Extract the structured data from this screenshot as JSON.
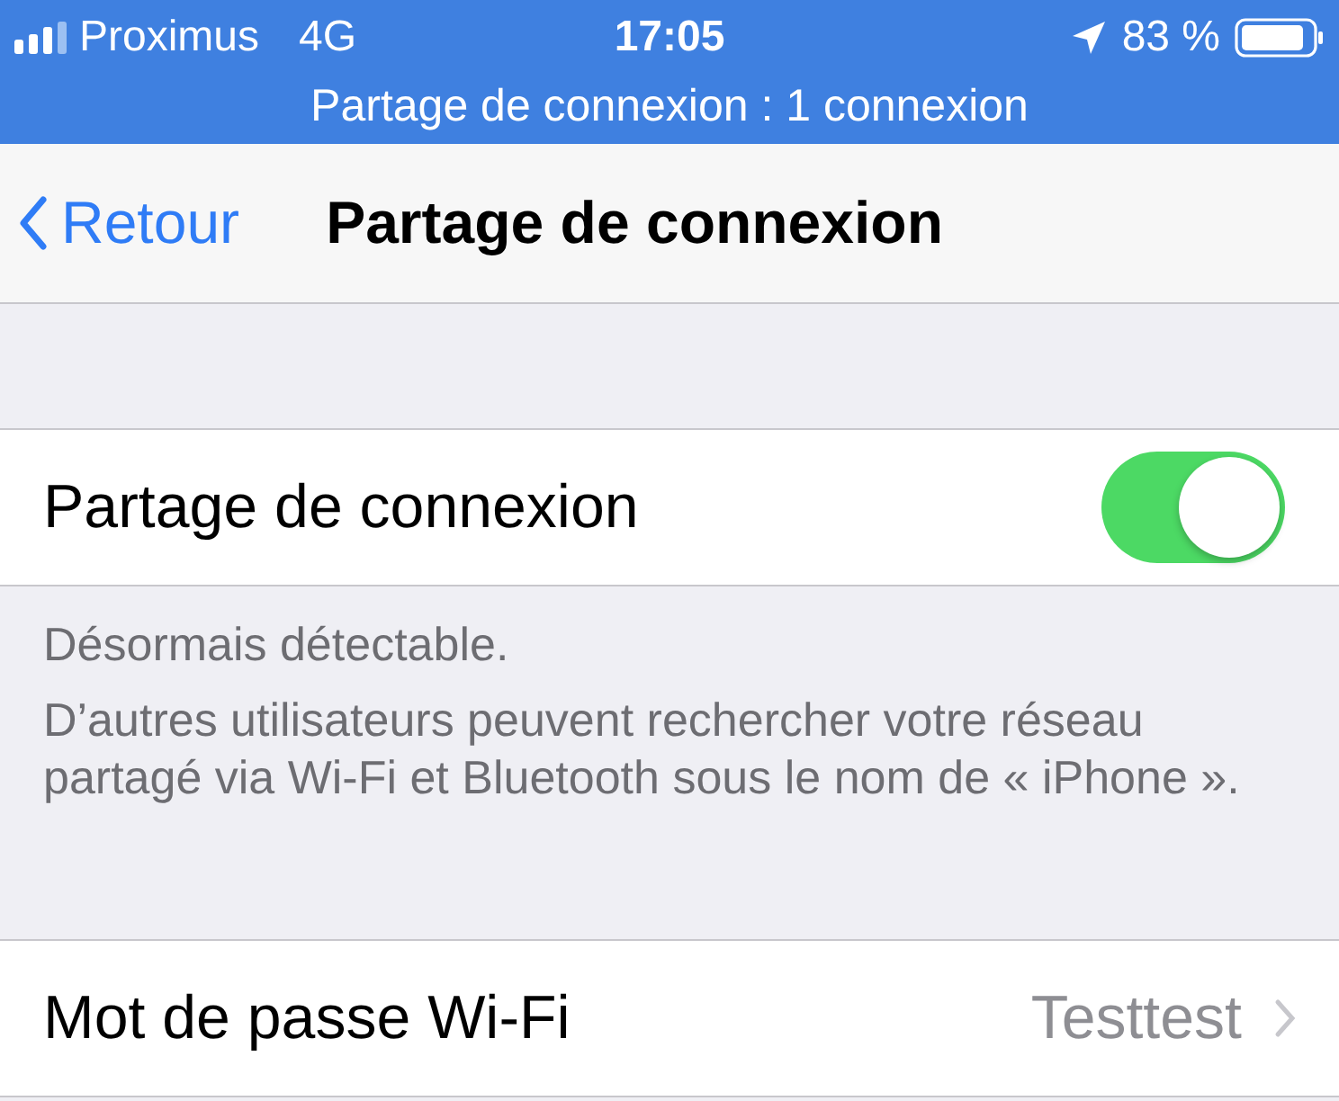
{
  "status_bar": {
    "carrier": "Proximus",
    "network": "4G",
    "time": "17:05",
    "battery": "83 %"
  },
  "hotspot_banner": "Partage de connexion : 1 connexion",
  "nav": {
    "back": "Retour",
    "title": "Partage de connexion"
  },
  "toggle_row": {
    "label": "Partage de connexion",
    "on": true
  },
  "footer": {
    "status": "Désormais détectable.",
    "description": "D’autres utilisateurs peuvent rechercher votre réseau partagé via Wi-Fi et Bluetooth sous le nom de « iPhone »."
  },
  "password_row": {
    "label": "Mot de passe Wi-Fi",
    "value": "Testtest"
  }
}
